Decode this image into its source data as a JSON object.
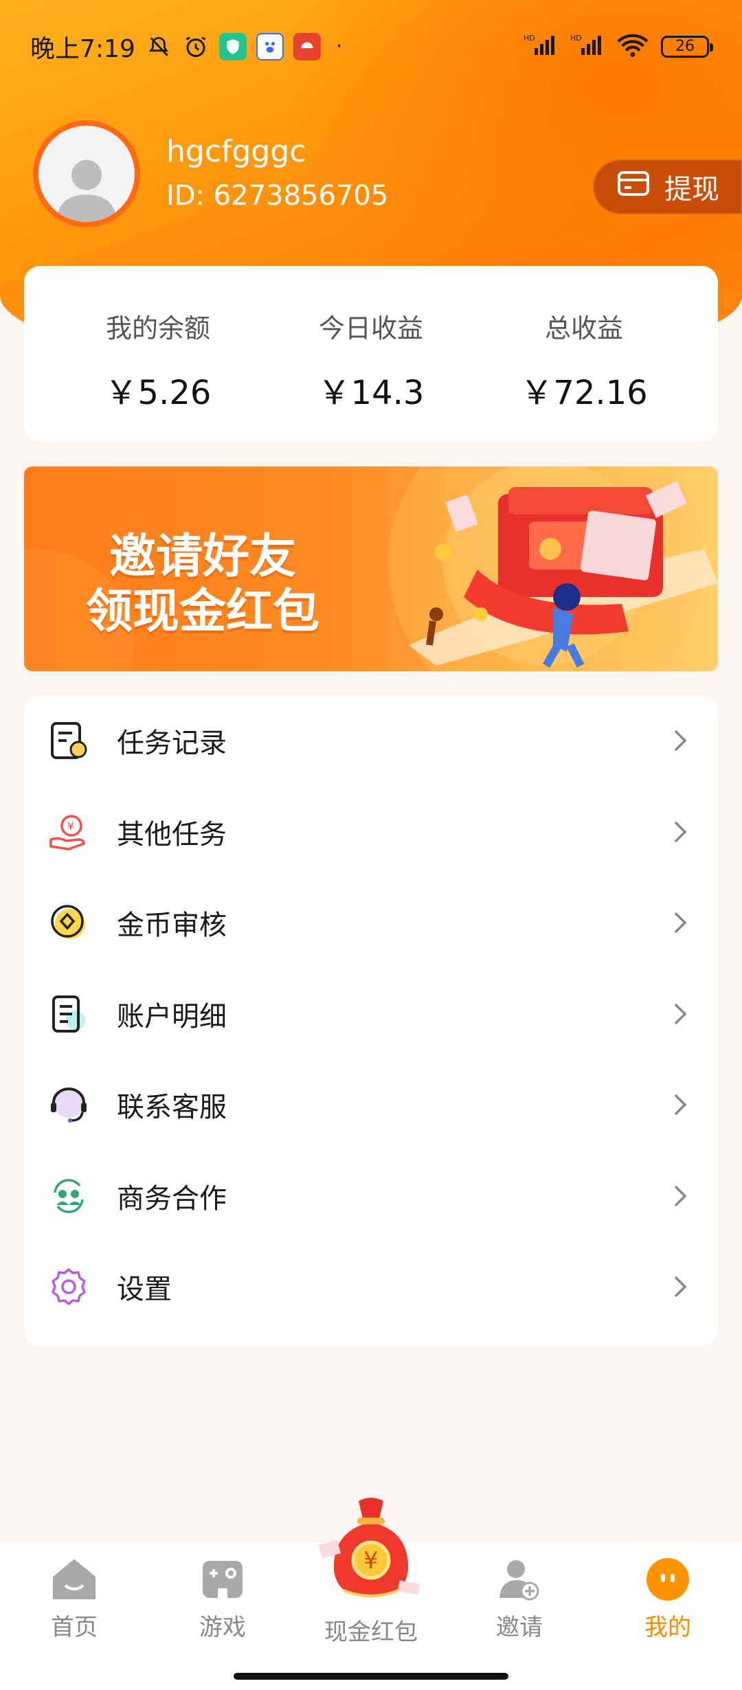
{
  "status_bar": {
    "time": "晚上7:19",
    "battery": "26"
  },
  "profile": {
    "username": "hgcfgggc",
    "user_id": "ID: 6273856705",
    "withdraw_label": "提现"
  },
  "stats": [
    {
      "label": "我的余额",
      "value": "￥5.26"
    },
    {
      "label": "今日收益",
      "value": "￥14.3"
    },
    {
      "label": "总收益",
      "value": "￥72.16"
    }
  ],
  "banner": {
    "line1": "邀请好友",
    "line2": "领现金红包"
  },
  "menu": [
    {
      "label": "任务记录",
      "icon": "task-record-icon"
    },
    {
      "label": "其他任务",
      "icon": "other-tasks-icon"
    },
    {
      "label": "金币审核",
      "icon": "coin-review-icon"
    },
    {
      "label": "账户明细",
      "icon": "account-details-icon"
    },
    {
      "label": "联系客服",
      "icon": "customer-service-icon"
    },
    {
      "label": "商务合作",
      "icon": "business-cooperation-icon"
    },
    {
      "label": "设置",
      "icon": "settings-icon"
    }
  ],
  "tabs": [
    {
      "label": "首页",
      "icon": "home-icon"
    },
    {
      "label": "游戏",
      "icon": "game-icon"
    },
    {
      "label": "现金红包",
      "icon": "red-packet-bag-icon"
    },
    {
      "label": "邀请",
      "icon": "invite-icon"
    },
    {
      "label": "我的",
      "icon": "me-icon",
      "active": true
    }
  ],
  "colors": {
    "accent": "#FF8A00",
    "hero": "#FF7D06",
    "withdraw_bg": "#C94D06"
  }
}
